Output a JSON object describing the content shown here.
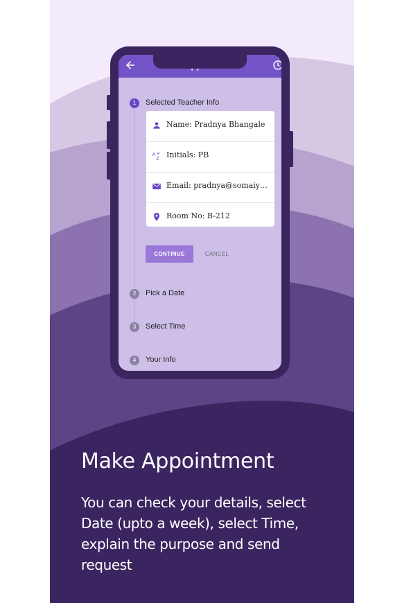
{
  "colors": {
    "background_top": "#f3eafb",
    "appbar": "#7254c6",
    "screen": "#cdbfe8",
    "accent": "#6a45c3",
    "button": "#9a78d9",
    "bottom_panel": "#3a2560"
  },
  "appbar": {
    "title": "Book Appointment",
    "back_icon": "arrow-back-icon",
    "right_icon": "history-icon"
  },
  "steps": [
    {
      "number": "1",
      "label": "Selected Teacher Info",
      "state": "active"
    },
    {
      "number": "2",
      "label": "Pick a Date",
      "state": "inactive"
    },
    {
      "number": "3",
      "label": "Select Time",
      "state": "inactive"
    },
    {
      "number": "4",
      "label": "Your Info",
      "state": "inactive"
    }
  ],
  "teacher_info": [
    {
      "icon": "person-icon",
      "text": "Name: Pradnya Bhangale"
    },
    {
      "icon": "sort-alpha-icon",
      "text": "Initials: PB"
    },
    {
      "icon": "email-icon",
      "text": "Email: pradnya@somaiya..."
    },
    {
      "icon": "location-pin-icon",
      "text": "Room No: B-212"
    }
  ],
  "buttons": {
    "continue": "CONTINUE",
    "cancel": "CANCEL"
  },
  "caption": {
    "title": "Make Appointment",
    "body": "You can check your details, select Date (upto a week), select Time, explain the purpose and send request"
  }
}
